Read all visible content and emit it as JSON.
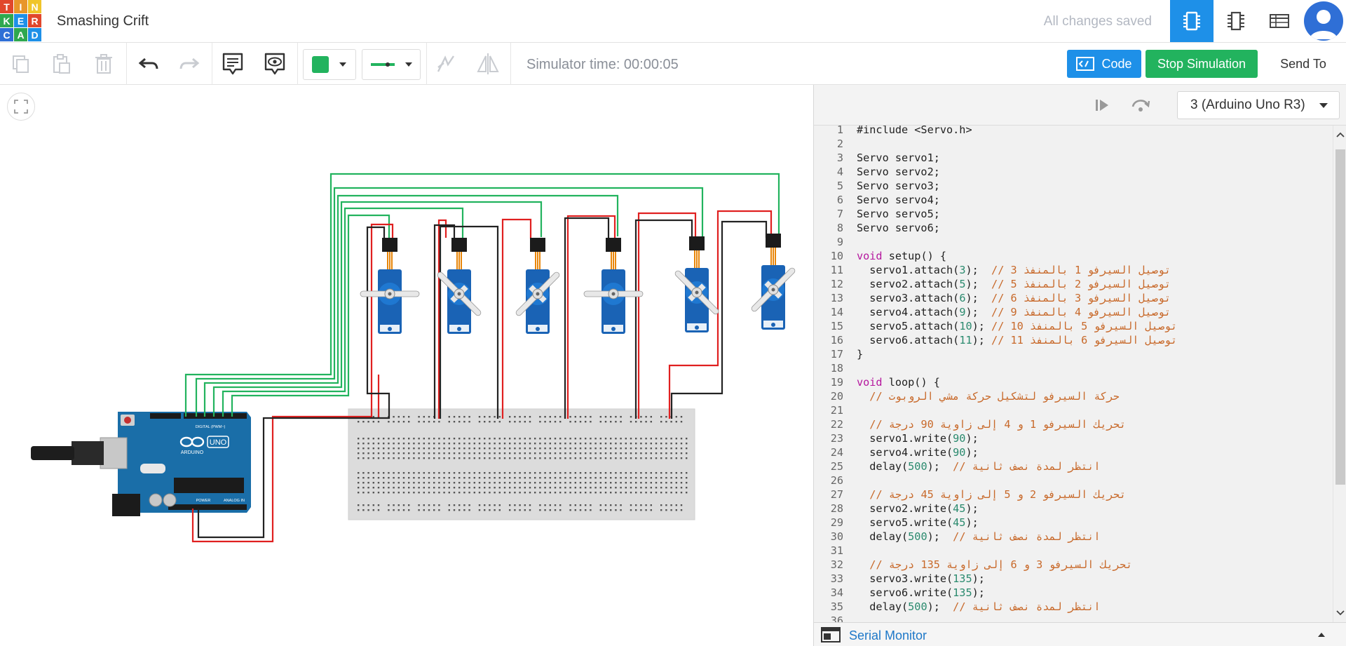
{
  "header": {
    "logo_letters": [
      "T",
      "I",
      "N",
      "K",
      "E",
      "R",
      "C",
      "A",
      "D"
    ],
    "logo_colors": [
      "#e1472c",
      "#e8962a",
      "#f0c52a",
      "#2fa84f",
      "#1e90e8",
      "#e1472c",
      "#2f6fd6",
      "#2fa84f",
      "#1e90e8"
    ],
    "project_title": "Smashing Crift",
    "save_status": "All changes saved",
    "view_buttons": [
      "circuit-view-icon",
      "schematic-view-icon",
      "component-list-icon"
    ],
    "accent": "#1e90e8"
  },
  "toolbar": {
    "sim_time": "Simulator time: 00:00:05",
    "code_label": "Code",
    "stop_label": "Stop Simulation",
    "send_label": "Send To",
    "fill_color": "#22b35e",
    "wire_color": "#22b35e"
  },
  "code_panel": {
    "device": "3 (Arduino Uno R3)",
    "serial_monitor": "Serial Monitor",
    "lines": [
      {
        "n": "1",
        "t": "#include <Servo.h>"
      },
      {
        "n": "2",
        "t": ""
      },
      {
        "n": "3",
        "t": "Servo servo1;"
      },
      {
        "n": "4",
        "t": "Servo servo2;"
      },
      {
        "n": "5",
        "t": "Servo servo3;"
      },
      {
        "n": "6",
        "t": "Servo servo4;"
      },
      {
        "n": "7",
        "t": "Servo servo5;"
      },
      {
        "n": "8",
        "t": "Servo servo6;"
      },
      {
        "n": "9",
        "t": ""
      },
      {
        "n": "10",
        "t": "void setup() {"
      },
      {
        "n": "11",
        "t": "  servo1.attach(3);  // توصيل السيرفو 1 بالمنفذ 3"
      },
      {
        "n": "12",
        "t": "  servo2.attach(5);  // توصيل السيرفو 2 بالمنفذ 5"
      },
      {
        "n": "13",
        "t": "  servo3.attach(6);  // توصيل السيرفو 3 بالمنفذ 6"
      },
      {
        "n": "14",
        "t": "  servo4.attach(9);  // توصيل السيرفو 4 بالمنفذ 9"
      },
      {
        "n": "15",
        "t": "  servo5.attach(10); // توصيل السيرفو 5 بالمنفذ 10"
      },
      {
        "n": "16",
        "t": "  servo6.attach(11); // توصيل السيرفو 6 بالمنفذ 11"
      },
      {
        "n": "17",
        "t": "}"
      },
      {
        "n": "18",
        "t": ""
      },
      {
        "n": "19",
        "t": "void loop() {"
      },
      {
        "n": "20",
        "t": "  // حركة السيرفو لتشكيل حركة مشي الروبوت"
      },
      {
        "n": "21",
        "t": ""
      },
      {
        "n": "22",
        "t": "  // تحريك السيرفو 1 و 4 إلى زاوية 90 درجة"
      },
      {
        "n": "23",
        "t": "  servo1.write(90);"
      },
      {
        "n": "24",
        "t": "  servo4.write(90);"
      },
      {
        "n": "25",
        "t": "  delay(500);  // انتظر لمدة نصف ثانية"
      },
      {
        "n": "26",
        "t": ""
      },
      {
        "n": "27",
        "t": "  // تحريك السيرفو 2 و 5 إلى زاوية 45 درجة"
      },
      {
        "n": "28",
        "t": "  servo2.write(45);"
      },
      {
        "n": "29",
        "t": "  servo5.write(45);"
      },
      {
        "n": "30",
        "t": "  delay(500);  // انتظر لمدة نصف ثانية"
      },
      {
        "n": "31",
        "t": ""
      },
      {
        "n": "32",
        "t": "  // تحريك السيرفو 3 و 6 إلى زاوية 135 درجة"
      },
      {
        "n": "33",
        "t": "  servo3.write(135);"
      },
      {
        "n": "34",
        "t": "  servo6.write(135);"
      },
      {
        "n": "35",
        "t": "  delay(500);  // انتظر لمدة نصف ثانية"
      },
      {
        "n": "36",
        "t": ""
      }
    ]
  },
  "circuit": {
    "arduino_logo": "ARDUINO",
    "arduino_model": "UNO",
    "digital_label": "DIGITAL (PWM~)",
    "power_label": "POWER",
    "analog_label": "ANALOG IN",
    "servo_count": 6
  }
}
